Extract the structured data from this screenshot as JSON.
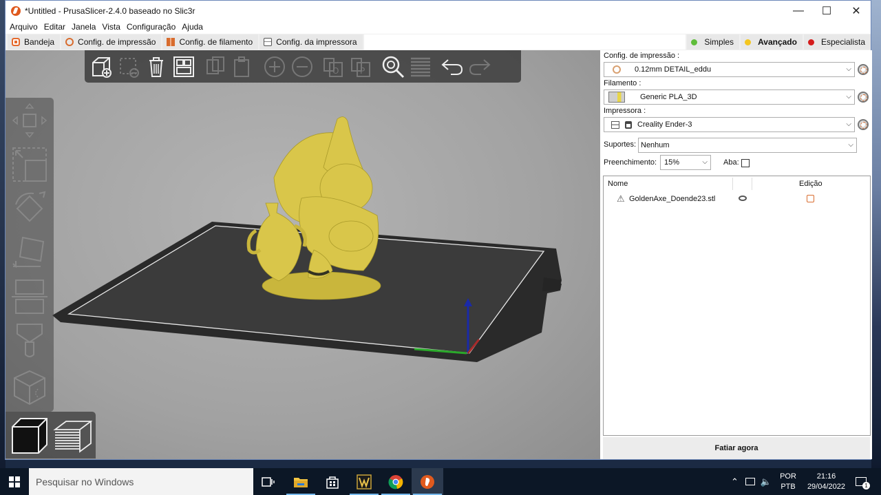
{
  "window": {
    "title": "*Untitled - PrusaSlicer-2.4.0 baseado no Slic3r",
    "controls": {
      "minimize": "—",
      "maximize": "☐",
      "close": "✕"
    }
  },
  "menubar": [
    "Arquivo",
    "Editar",
    "Janela",
    "Vista",
    "Configuração",
    "Ajuda"
  ],
  "tabs": {
    "plater": "Bandeja",
    "print": "Config. de impressão",
    "filament": "Config. de filamento",
    "printer": "Config. da impressora"
  },
  "modes": [
    {
      "label": "Simples",
      "color": "#5fbd3a",
      "active": false
    },
    {
      "label": "Avançado",
      "color": "#f4c61f",
      "active": true
    },
    {
      "label": "Especialista",
      "color": "#d41c1c",
      "active": false
    }
  ],
  "top_toolbar_icons": [
    "add-icon",
    "delete-icon",
    "delete-all-icon",
    "arrange-icon",
    "copy-icon",
    "paste-icon",
    "increase-instances-icon",
    "decrease-instances-icon",
    "split-to-objects-icon",
    "split-to-parts-icon",
    "search-icon",
    "layers-editing-icon",
    "undo-icon",
    "redo-icon"
  ],
  "left_toolbar_icons": [
    "move-icon",
    "scale-icon",
    "rotate-icon",
    "place-on-face-icon",
    "cut-icon",
    "paint-supports-icon",
    "seam-painting-icon"
  ],
  "view_toolbar_icons": [
    "3d-view-icon",
    "preview-icon"
  ],
  "sidebar": {
    "print_label": "Config. de impressão :",
    "print_value": "0.12mm DETAIL_eddu",
    "filament_label": "Filamento :",
    "filament_value": "Generic PLA_3D",
    "printer_label": "Impressora :",
    "printer_value": "Creality Ender-3",
    "supports_label": "Suportes:",
    "supports_value": "Nenhum",
    "infill_label": "Preenchimento:",
    "infill_value": "15%",
    "brim_label": "Aba:",
    "brim_checked": false,
    "list_header_name": "Nome",
    "list_header_edit": "Edição",
    "objects": [
      {
        "name": "GoldenAxe_Doende23.stl",
        "warning": true,
        "visible": true
      }
    ],
    "slice_button": "Fatiar agora"
  },
  "taskbar": {
    "search_placeholder": "Pesquisar no Windows",
    "lang_top": "POR",
    "lang_bottom": "PTB",
    "time": "21:16",
    "date": "29/04/2022",
    "notification_count": "1"
  },
  "colors": {
    "accent": "#e56a2d",
    "model": "#d9c64a",
    "bed": "#2c2c2c"
  }
}
